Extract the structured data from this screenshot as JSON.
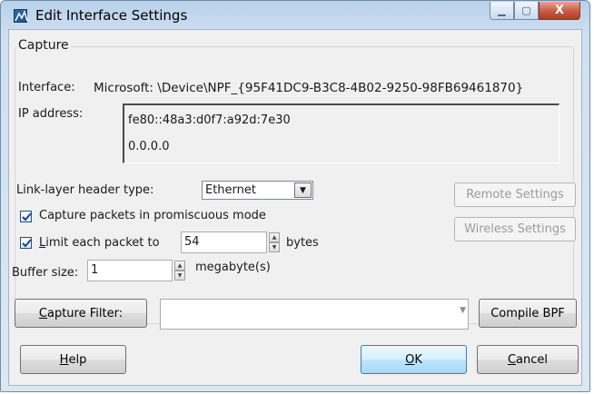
{
  "window": {
    "title": "Edit Interface Settings",
    "buttons": {
      "minimize": "▁",
      "maximize": "▢",
      "close": "X"
    }
  },
  "capture": {
    "group_title": "Capture",
    "interface_label": "Interface:",
    "interface_value": "Microsoft: \\Device\\NPF_{95F41DC9-B3C8-4B02-9250-98FB69461870}",
    "ip_label": "IP address:",
    "ip_addresses": [
      "fe80::48a3:d0f7:a92d:7e30",
      "0.0.0.0"
    ],
    "link_layer_label": "Link-layer header type:",
    "link_layer_value": "Ethernet",
    "remote_settings": "Remote Settings",
    "wireless_settings": "Wireless Settings",
    "promiscuous": {
      "label": "Capture packets in promiscuous mode",
      "checked": true
    },
    "limit": {
      "label_pre": "",
      "label_underlined": "L",
      "label_post": "imit each packet to",
      "checked": true,
      "value": "54",
      "unit": "bytes"
    },
    "buffer": {
      "label": "Buffer size:",
      "value": "1",
      "unit": "megabyte(s)"
    }
  },
  "filter": {
    "button_underlined": "C",
    "button_rest": "apture Filter:",
    "value": "",
    "compile": "Compile BPF"
  },
  "footer": {
    "help_underlined": "H",
    "help_rest": "elp",
    "ok_underlined": "O",
    "ok_rest": "K",
    "cancel_underlined": "C",
    "cancel_rest": "ancel"
  }
}
